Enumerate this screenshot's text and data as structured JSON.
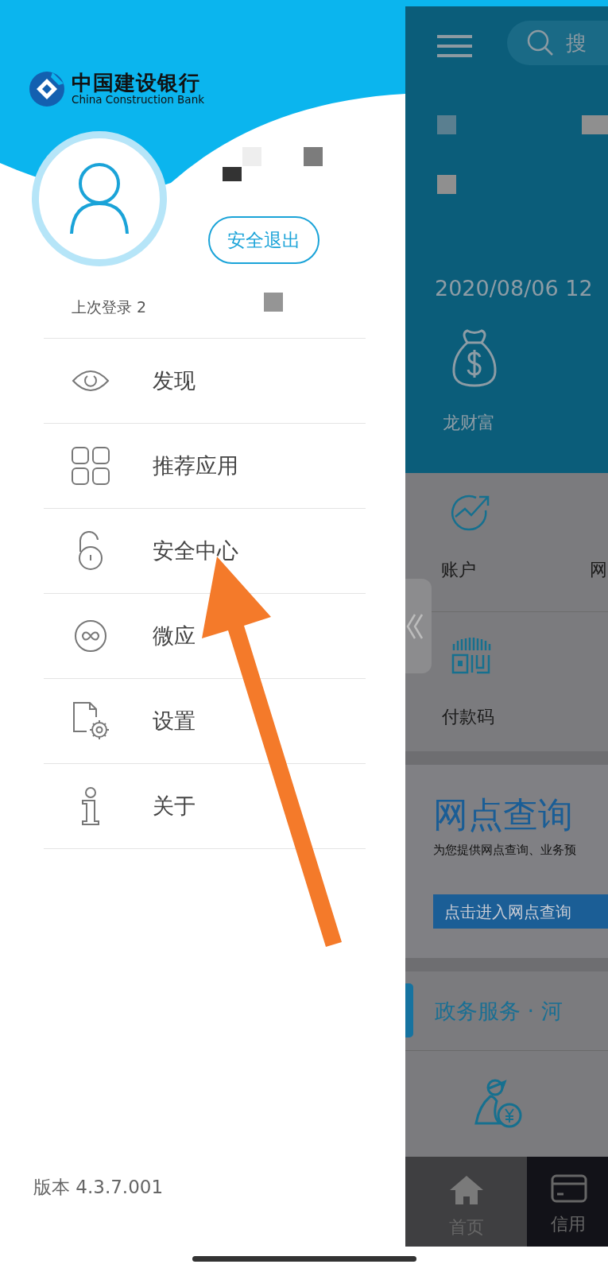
{
  "drawer": {
    "logo": {
      "name_cn": "中国建设银行",
      "name_en": "China Construction Bank"
    },
    "logout_button": "安全退出",
    "last_login": "上次登录 2",
    "menu": [
      {
        "label": "发现",
        "kind": "eye"
      },
      {
        "label": "推荐应用",
        "kind": "grid"
      },
      {
        "label": "安全中心",
        "kind": "lock"
      },
      {
        "label": "微应",
        "kind": "link"
      },
      {
        "label": "设置",
        "kind": "settings"
      },
      {
        "label": "关于",
        "kind": "info"
      }
    ],
    "version": "版本 4.3.7.001"
  },
  "home_screen": {
    "search": {
      "placeholder": "搜"
    },
    "date": "2020/08/06 12",
    "wealth_label": "龙财富",
    "shortcuts": [
      {
        "label": "账户",
        "kind": "chart"
      },
      {
        "label": "网",
        "kind": "none"
      },
      {
        "label": "付款码",
        "kind": "paycode"
      }
    ],
    "banner": {
      "title": "网点查询",
      "subtitle": "为您提供网点查询、业务预",
      "button": "点击进入网点查询"
    },
    "section": {
      "title": "政务服务 · 河"
    },
    "tab_bar": [
      {
        "label": "首页",
        "kind": "home",
        "selected": true
      },
      {
        "label": "信用",
        "kind": "card",
        "selected": false
      }
    ]
  }
}
